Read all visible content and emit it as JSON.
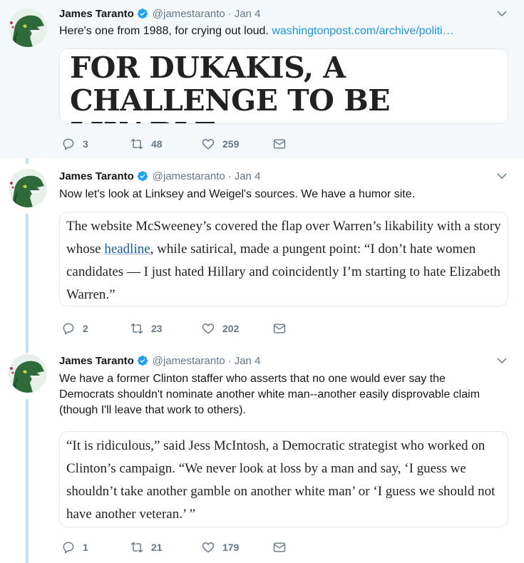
{
  "tweets": [
    {
      "name": "James Taranto",
      "handle": "@jamestaranto",
      "date": "Jan 4",
      "text": "Here's one from 1988, for crying out loud. ",
      "link": "washingtonpost.com/archive/politi…",
      "card_type": "headline",
      "card_text": "FOR DUKAKIS, A CHALLENGE TO BE LIKABLE",
      "replies": "3",
      "retweets": "48",
      "likes": "259"
    },
    {
      "name": "James Taranto",
      "handle": "@jamestaranto",
      "date": "Jan 4",
      "text": "Now let's look at Linksey and Weigel's sources. We have a humor site.",
      "card_type": "quote",
      "card_before": "The website McSweeney’s covered the flap over Warren’s likability with a story whose ",
      "card_link": "headline",
      "card_after": ", while satirical, made a pungent point: “I don’t hate women candidates — I just hated Hillary and coincidently I’m starting to hate Elizabeth Warren.”",
      "replies": "2",
      "retweets": "23",
      "likes": "202"
    },
    {
      "name": "James Taranto",
      "handle": "@jamestaranto",
      "date": "Jan 4",
      "text": "We have a former Clinton staffer who asserts that no one would ever say the Democrats shouldn't nominate another white man--another easily disprovable claim (though I'll leave that work to others).",
      "card_type": "quote",
      "card_text": "“It is ridiculous,” said Jess McIntosh, a Democratic strategist who worked on Clinton’s campaign. “We never look at loss by a man and say, ‘I guess we shouldn’t take another gamble on another white man’ or ‘I guess we should not have another veteran.’ ”",
      "replies": "1",
      "retweets": "21",
      "likes": "179"
    }
  ],
  "colors": {
    "accent": "#1b95e0",
    "thread_line": "#c4e2f5",
    "muted": "#657786",
    "highlight_bg": "#f5f8fa"
  },
  "icons": [
    "verified-icon",
    "chevron-down-icon",
    "reply-icon",
    "retweet-icon",
    "like-icon",
    "dm-icon"
  ]
}
